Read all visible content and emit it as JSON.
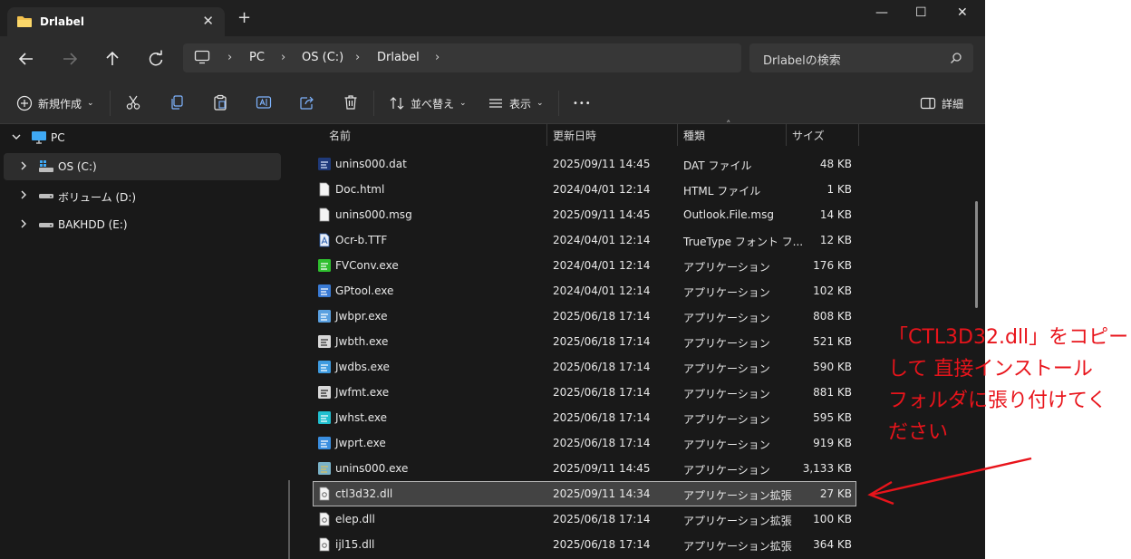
{
  "window": {
    "tab_title": "Drlabel",
    "new_tab": "+",
    "minimize": "—",
    "maximize": "☐",
    "close": "✕",
    "tab_close": "✕"
  },
  "address": {
    "crumbs": [
      "PC",
      "OS (C:)",
      "Drlabel"
    ],
    "search_placeholder": "Drlabelの検索"
  },
  "toolbar": {
    "new_label": "新規作成",
    "sort_label": "並べ替え",
    "view_label": "表示",
    "more_label": "•••",
    "details_label": "詳細"
  },
  "nav": {
    "items": [
      {
        "label": "PC",
        "icon": "pc-icon"
      },
      {
        "label": "OS (C:)",
        "icon": "windows-drive-icon"
      },
      {
        "label": "ボリューム (D:)",
        "icon": "drive-icon"
      },
      {
        "label": "BAKHDD (E:)",
        "icon": "drive-icon"
      }
    ]
  },
  "columns": {
    "name": "名前",
    "date": "更新日時",
    "type": "種類",
    "size": "サイズ"
  },
  "files": [
    {
      "name": "unins000.dat",
      "date": "2025/09/11 14:45",
      "type": "DAT ファイル",
      "size": "48 KB",
      "icon": "dat-file-icon"
    },
    {
      "name": "Doc.html",
      "date": "2024/04/01 12:14",
      "type": "HTML ファイル",
      "size": "1 KB",
      "icon": "html-file-icon"
    },
    {
      "name": "unins000.msg",
      "date": "2025/09/11 14:45",
      "type": "Outlook.File.msg",
      "size": "14 KB",
      "icon": "msg-file-icon"
    },
    {
      "name": "Ocr-b.TTF",
      "date": "2024/04/01 12:14",
      "type": "TrueType フォント フ...",
      "size": "12 KB",
      "icon": "font-file-icon"
    },
    {
      "name": "FVConv.exe",
      "date": "2024/04/01 12:14",
      "type": "アプリケーション",
      "size": "176 KB",
      "icon": "fvconv-app-icon"
    },
    {
      "name": "GPtool.exe",
      "date": "2024/04/01 12:14",
      "type": "アプリケーション",
      "size": "102 KB",
      "icon": "gptool-app-icon"
    },
    {
      "name": "Jwbpr.exe",
      "date": "2025/06/18 17:14",
      "type": "アプリケーション",
      "size": "808 KB",
      "icon": "jwbpr-app-icon"
    },
    {
      "name": "Jwbth.exe",
      "date": "2025/06/18 17:14",
      "type": "アプリケーション",
      "size": "521 KB",
      "icon": "jwbth-app-icon"
    },
    {
      "name": "Jwdbs.exe",
      "date": "2025/06/18 17:14",
      "type": "アプリケーション",
      "size": "590 KB",
      "icon": "jwdbs-app-icon"
    },
    {
      "name": "Jwfmt.exe",
      "date": "2025/06/18 17:14",
      "type": "アプリケーション",
      "size": "881 KB",
      "icon": "jwfmt-app-icon"
    },
    {
      "name": "Jwhst.exe",
      "date": "2025/06/18 17:14",
      "type": "アプリケーション",
      "size": "595 KB",
      "icon": "jwhst-app-icon"
    },
    {
      "name": "Jwprt.exe",
      "date": "2025/06/18 17:14",
      "type": "アプリケーション",
      "size": "919 KB",
      "icon": "jwprt-app-icon"
    },
    {
      "name": "unins000.exe",
      "date": "2025/09/11 14:45",
      "type": "アプリケーション",
      "size": "3,133 KB",
      "icon": "uninstaller-app-icon"
    },
    {
      "name": "ctl3d32.dll",
      "date": "2025/09/11 14:34",
      "type": "アプリケーション拡張",
      "size": "27 KB",
      "icon": "dll-file-icon",
      "selected": true
    },
    {
      "name": "elep.dll",
      "date": "2025/06/18 17:14",
      "type": "アプリケーション拡張",
      "size": "100 KB",
      "icon": "dll-file-icon"
    },
    {
      "name": "ijl15.dll",
      "date": "2025/06/18 17:14",
      "type": "アプリケーション拡張",
      "size": "364 KB",
      "icon": "dll-file-icon"
    }
  ],
  "annotation": {
    "text": "「CTL3D32.dll」をコピー\nして 直接インストール\nフォルダに張り付けてく\nださい",
    "color": "#e8141b"
  },
  "colors": {
    "window_bg": "#191919",
    "bar_bg": "#2c2c2c",
    "selection": "#434343"
  }
}
